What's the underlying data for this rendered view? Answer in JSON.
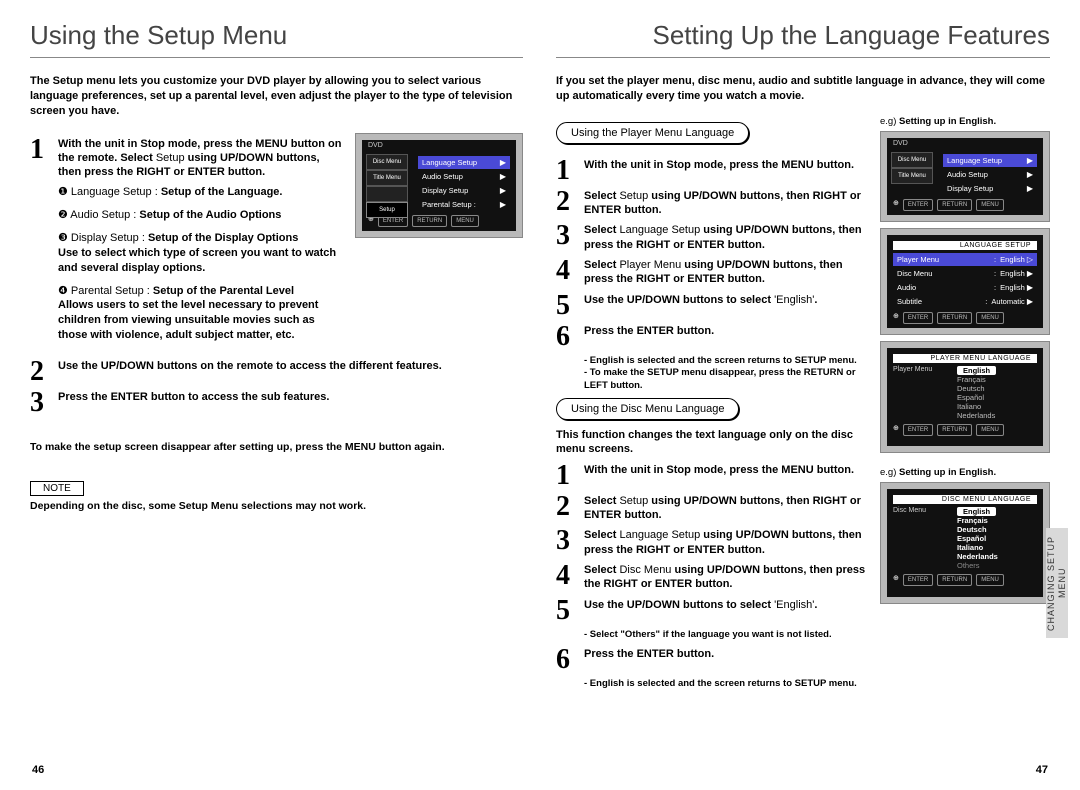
{
  "left": {
    "heading": "Using the Setup Menu",
    "intro": "The Setup menu lets you customize your DVD player by allowing you to select various language preferences, set up a parental level, even adjust the player to the type of television screen you have.",
    "step1_a": "With the unit in Stop mode, press the MENU button on the remote. Select ",
    "step1_b": "Setup",
    "step1_c": " using UP/DOWN buttons, then press the RIGHT or ENTER button.",
    "bul1_lead": "❶ Language Setup : ",
    "bul1_bold": "Setup of the Language.",
    "bul2_lead": "❷ Audio Setup : ",
    "bul2_bold": "Setup of the Audio Options",
    "bul3_lead": "❸ Display Setup : ",
    "bul3_bold": "Setup of the Display Options",
    "bul3_desc": "Use to select which type of screen you want to watch and several display options.",
    "bul4_lead": "❹ Parental Setup : ",
    "bul4_bold": "Setup of the Parental Level",
    "bul4_desc": "Allows users to set the level necessary to prevent children from viewing unsuitable movies such as those with violence, adult subject matter, etc.",
    "step2": "Use the UP/DOWN buttons on the remote to access the different features.",
    "step3": "Press the ENTER button to access the sub features.",
    "footnote": "To make the setup screen disappear after setting up, press the MENU button again.",
    "note_label": "NOTE",
    "note_text": "Depending on the disc, some Setup Menu selections may not work.",
    "page_num": "46",
    "osd": {
      "dvd": "DVD",
      "tabs": [
        "Disc Menu",
        "Title Menu",
        " ",
        "Setup"
      ],
      "rows": [
        "Language Setup",
        "Audio Setup",
        "Display Setup",
        "Parental Setup :"
      ],
      "buttons": [
        "ENTER",
        "RETURN",
        "MENU"
      ]
    }
  },
  "right": {
    "heading": "Setting Up the Language Features",
    "intro": "If you set the player menu, disc menu, audio and subtitle language in advance, they will come up automatically every time you watch a movie.",
    "pill1": "Using the Player Menu Language",
    "p1_s1": "With the unit in Stop mode, press the MENU button.",
    "p1_s2_a": "Select ",
    "p1_s2_b": "Setup",
    "p1_s2_c": " using UP/DOWN buttons, then RIGHT or ENTER button.",
    "p1_s3_a": "Select ",
    "p1_s3_b": "Language Setup",
    "p1_s3_c": " using UP/DOWN buttons, then press the RIGHT or ENTER button.",
    "p1_s4_a": "Select ",
    "p1_s4_b": "Player Menu",
    "p1_s4_c": " using UP/DOWN buttons, then press the RIGHT or ENTER button.",
    "p1_s5_a": "Use the UP/DOWN buttons to select ",
    "p1_s5_b": "'English'",
    "p1_s5_c": ".",
    "p1_s6": "Press the ENTER button.",
    "p1_n1": "- English is selected and the screen returns to SETUP menu.",
    "p1_n2": "- To make the SETUP menu disappear, press the RETURN or LEFT button.",
    "pill2": "Using the Disc Menu Language",
    "p2_intro": "This function changes the text language only on the disc menu screens.",
    "p2_s1": "With the unit in Stop mode, press the MENU button.",
    "p2_s2_a": "Select ",
    "p2_s2_b": "Setup",
    "p2_s2_c": " using UP/DOWN buttons, then RIGHT or ENTER button.",
    "p2_s3_a": "Select ",
    "p2_s3_b": "Language Setup",
    "p2_s3_c": " using UP/DOWN buttons, then press the RIGHT or ENTER button.",
    "p2_s4_a": "Select ",
    "p2_s4_b": "Disc Menu",
    "p2_s4_c": " using UP/DOWN buttons, then press the RIGHT or ENTER button.",
    "p2_s5_a": "Use the UP/DOWN buttons to select ",
    "p2_s5_b": "'English'",
    "p2_s5_c": ".",
    "p2_n1": "- Select \"Others\" if the language you want is not listed.",
    "p2_s6": "Press the ENTER button.",
    "p2_n2": "- English is selected and the screen returns to SETUP menu.",
    "eg1_a": "e.g) ",
    "eg1_b": "Setting up in English.",
    "eg2_a": "e.g) ",
    "eg2_b": "Setting up in English.",
    "page_num": "47",
    "side_tab": "CHANGING\nSETUP MENU",
    "osd1": {
      "dvd": "DVD",
      "tabs": [
        "Disc Menu",
        "Title Menu"
      ],
      "rows_hi": "Language Setup",
      "rows": [
        "Audio Setup",
        "Display Setup"
      ],
      "buttons": [
        "ENTER",
        "RETURN",
        "MENU"
      ]
    },
    "osd2": {
      "band": "LANGUAGE SETUP",
      "rows": [
        {
          "k": "Player Menu",
          "v": "English",
          "hi": true
        },
        {
          "k": "Disc Menu",
          "v": "English"
        },
        {
          "k": "Audio",
          "v": "English"
        },
        {
          "k": "Subtitle",
          "v": "Automatic"
        }
      ],
      "buttons": [
        "ENTER",
        "RETURN",
        "MENU"
      ]
    },
    "osd3": {
      "band": "PLAYER MENU LANGUAGE",
      "left_label": "Player Menu",
      "sel": "English",
      "langs": [
        "Français",
        "Deutsch",
        "Español",
        "Italiano",
        "Nederlands"
      ],
      "buttons": [
        "ENTER",
        "RETURN",
        "MENU"
      ]
    },
    "osd4": {
      "band": "DISC MENU LANGUAGE",
      "left_label": "Disc Menu",
      "sel": "English",
      "langs": [
        "Français",
        "Deutsch",
        "Español",
        "Italiano",
        "Nederlands",
        "Others"
      ],
      "buttons": [
        "ENTER",
        "RETURN",
        "MENU"
      ]
    }
  }
}
